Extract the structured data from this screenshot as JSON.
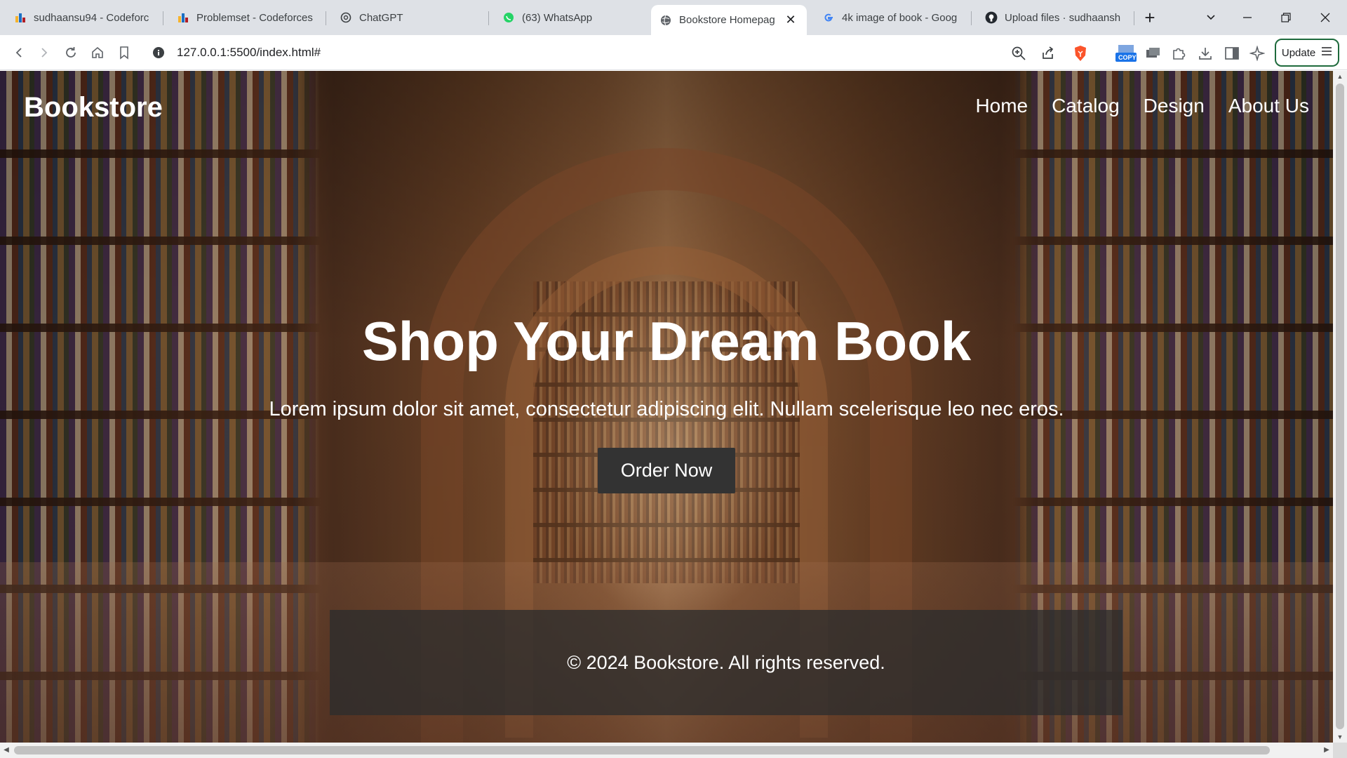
{
  "browser": {
    "tabs": [
      {
        "title": "sudhaansu94 - Codeforc",
        "icon": "codeforces-icon"
      },
      {
        "title": "Problemset - Codeforces",
        "icon": "codeforces-icon"
      },
      {
        "title": "ChatGPT",
        "icon": "chatgpt-icon"
      },
      {
        "title": "(63) WhatsApp",
        "icon": "whatsapp-icon"
      },
      {
        "title": "Bookstore Homepag",
        "icon": "globe-icon",
        "active": true
      },
      {
        "title": "4k image of book - Goog",
        "icon": "google-icon"
      },
      {
        "title": "Upload files · sudhaansh",
        "icon": "github-icon"
      }
    ],
    "url": "127.0.0.1:5500/index.html#",
    "update_label": "Update",
    "copy_badge": "COPY"
  },
  "page": {
    "brand": "Bookstore",
    "nav": [
      "Home",
      "Catalog",
      "Design",
      "About Us"
    ],
    "hero_title": "Shop Your Dream Book",
    "hero_subtitle": "Lorem ipsum dolor sit amet, consectetur adipiscing elit. Nullam scelerisque leo nec eros.",
    "cta_label": "Order Now",
    "footer_text": "© 2024 Bookstore. All rights reserved."
  },
  "colors": {
    "tabstrip": "#dee1e6",
    "cta_bg": "#333333",
    "footer_bg": "rgba(45,45,45,0.78)",
    "update_border": "#1e6a3c"
  }
}
